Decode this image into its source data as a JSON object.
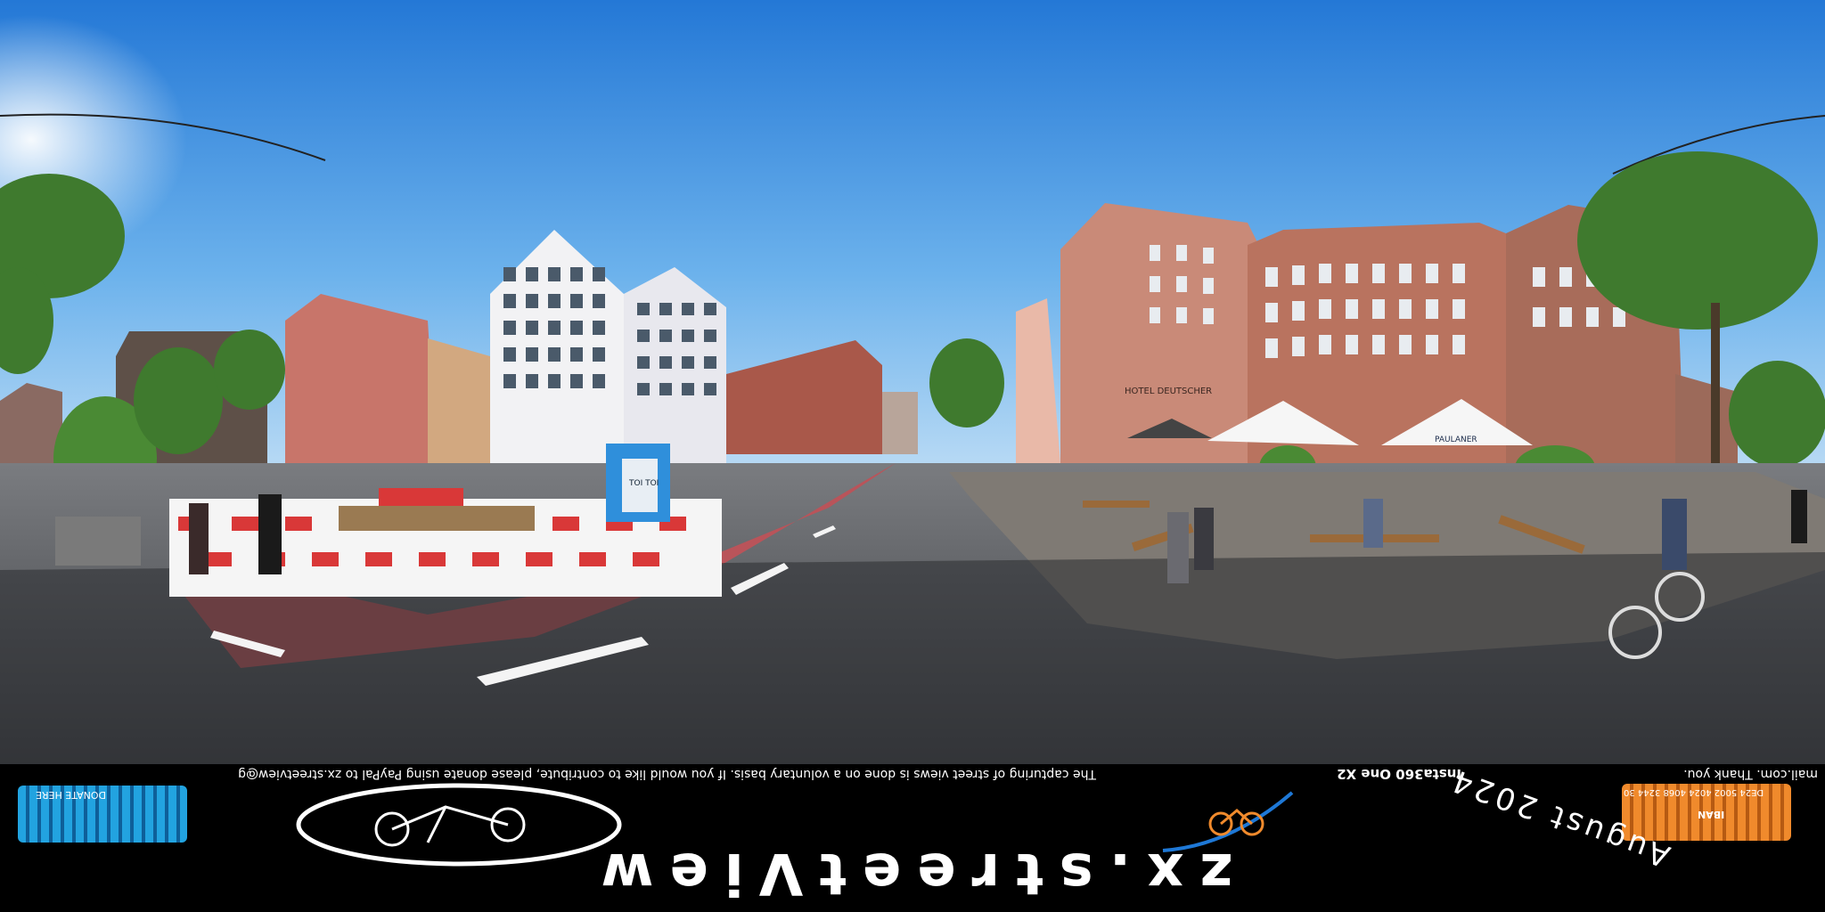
{
  "scene": {
    "description_tag": "equirectangular-street-panorama",
    "colors": {
      "sky_top": "#2a86dd",
      "sky_horizon": "#a9d2f2",
      "asphalt": "#4a4c50",
      "bike_lane": "#b9545a",
      "sandstone": "#c98a78",
      "foliage": "#3f7a2e"
    },
    "signs": {
      "hotel_sign": "HOTEL DEUTSCHER",
      "umbrella_brand": "PAULANER",
      "toilet_label": "TOI TOI"
    }
  },
  "banner": {
    "donate_text": "The capturing of street views is done on a voluntary basis. If you would like to contribute, please donate using PayPal to zx.streetview@g",
    "donate_text_right": "mail.com. Thank you.",
    "camera": "Insta360 One X2",
    "date": "August 2024",
    "logo_text": "zx.streetView",
    "paypal_label": "DONATE HERE",
    "iban_label": "IBAN",
    "iban_value": "DE24 5002 4024 4068 3244 30",
    "colors": {
      "paypal_qr": "#22a3e0",
      "iban_qr": "#f08a2c",
      "arc": "#1e78d6"
    }
  }
}
